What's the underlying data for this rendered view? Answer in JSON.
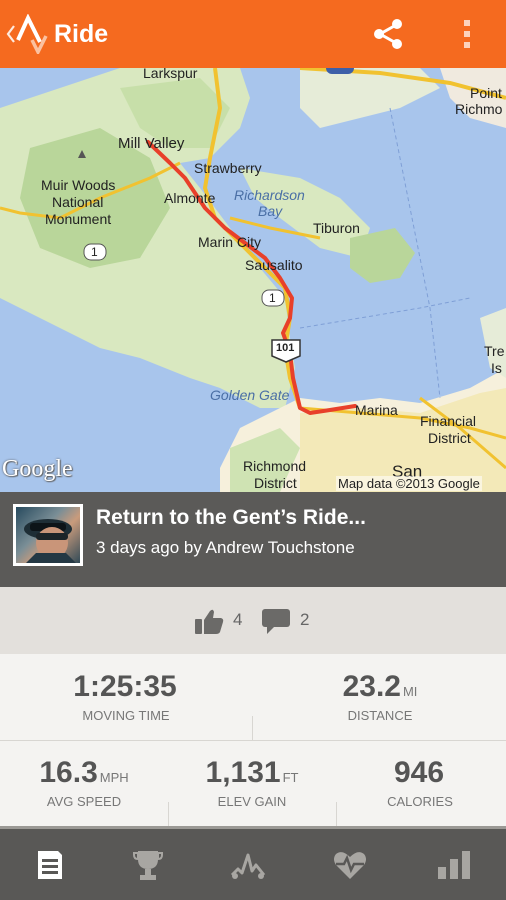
{
  "actionbar": {
    "title": "Ride",
    "icons": [
      "back-chevron-icon",
      "strava-logo-icon",
      "share-icon",
      "overflow-menu-icon"
    ],
    "color": "#f56a1f"
  },
  "map": {
    "labels": {
      "larkspur": "Larkspur",
      "mill_valley": "Mill Valley",
      "muir_woods": "Muir Woods",
      "national": "National",
      "monument": "Monument",
      "strawberry": "Strawberry",
      "almonte": "Almonte",
      "richardson": "Richardson",
      "bay": "Bay",
      "tiburon": "Tiburon",
      "marin_city": "Marin City",
      "sausalito": "Sausalito",
      "golden_gate": "Golden Gate",
      "marina": "Marina",
      "financial": "Financial",
      "district": "District",
      "richmond": "Richmond",
      "richmond_district": "District",
      "san": "San",
      "point": "Point",
      "richmo": "Richmo",
      "tre": "Tre",
      "is": "Is",
      "route1a": "1",
      "route1b": "1",
      "route101": "101"
    },
    "attribution_logo": "Google",
    "map_data": "Map data ©2013 Google",
    "route_color": "#e8402a"
  },
  "activity": {
    "name": "Return to the Gent’s Ride...",
    "subtitle": "3 days ago by Andrew Touchstone"
  },
  "social": {
    "kudos_count": "4",
    "comment_count": "2"
  },
  "stats": {
    "moving_time": {
      "value": "1:25:35",
      "unit": "",
      "label": "MOVING TIME"
    },
    "distance": {
      "value": "23.2",
      "unit": "MI",
      "label": "DISTANCE"
    },
    "avg_speed": {
      "value": "16.3",
      "unit": "MPH",
      "label": "AVG SPEED"
    },
    "elev_gain": {
      "value": "1,131",
      "unit": "FT",
      "label": "ELEV GAIN"
    },
    "calories": {
      "value": "946",
      "unit": "",
      "label": "CALORIES"
    }
  },
  "bottomnav": {
    "items": [
      "overview-icon",
      "trophy-icon",
      "analysis-icon",
      "heart-rate-icon",
      "bar-chart-icon"
    ],
    "selected": "overview-icon"
  }
}
